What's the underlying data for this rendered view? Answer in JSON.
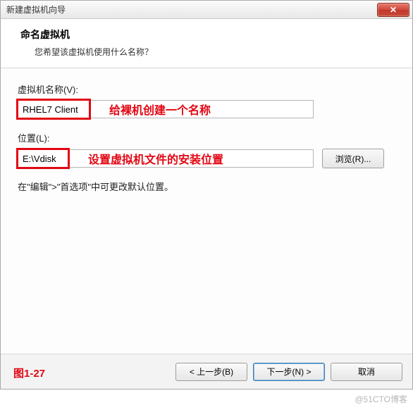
{
  "window": {
    "title": "新建虚拟机向导",
    "close_glyph": "✕"
  },
  "header": {
    "title": "命名虚拟机",
    "subtitle": "您希望该虚拟机使用什么名称？"
  },
  "fields": {
    "name_label": "虚拟机名称(V):",
    "name_value": "RHEL7 Client",
    "name_annotation": "给裸机创建一个名称",
    "location_label": "位置(L):",
    "location_value": "E:\\Vdisk",
    "location_annotation": "设置虚拟机文件的安装位置",
    "browse_label": "浏览(R)..."
  },
  "hint": "在\"编辑\">\"首选项\"中可更改默认位置。",
  "footer": {
    "figure_label": "图1-27",
    "back_label": "< 上一步(B)",
    "next_label": "下一步(N) >",
    "cancel_label": "取消"
  },
  "watermark": "@51CTO博客"
}
